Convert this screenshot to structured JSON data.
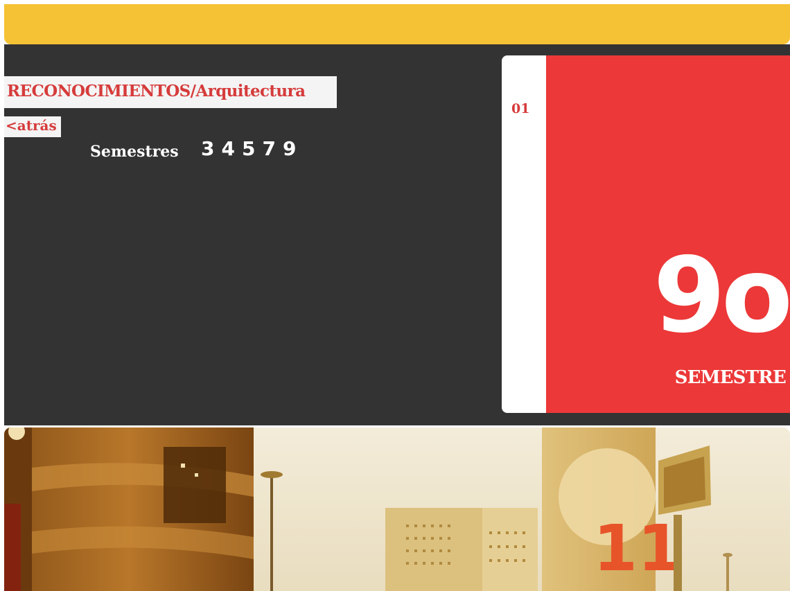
{
  "header": {
    "title": "RECONOCIMIENTOS/Arquitectura",
    "back_label": "<atrás"
  },
  "semesters": {
    "label": "Semestres",
    "items": [
      "3",
      "4",
      "5",
      "7",
      "9"
    ]
  },
  "card": {
    "index": "01",
    "big_text": "9o",
    "sub_text": "SEMESTRE"
  },
  "photo": {
    "sign_number": "11"
  },
  "colors": {
    "accent_yellow": "#f6c235",
    "panel_dark": "#333333",
    "accent_red": "#ec3838",
    "text_red": "#d63b3b"
  }
}
